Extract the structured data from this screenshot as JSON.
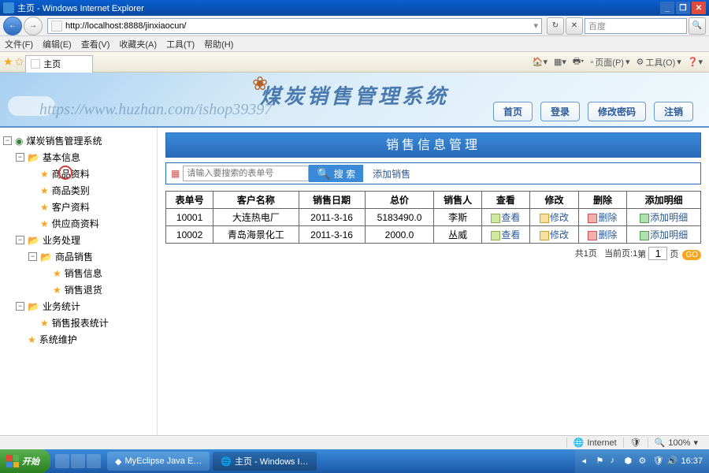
{
  "window": {
    "title": "主页 - Windows Internet Explorer",
    "url": "http://localhost:8888/jinxiaocun/",
    "search_engine_placeholder": "百度"
  },
  "menubar": [
    "文件(F)",
    "编辑(E)",
    "查看(V)",
    "收藏夹(A)",
    "工具(T)",
    "帮助(H)"
  ],
  "tab": {
    "title": "主页"
  },
  "ie_toolbar": {
    "page": "页面(P)",
    "tools": "工具(O)"
  },
  "banner": {
    "system_title": "煤炭销售管理系统",
    "watermark": "https://www.huzhan.com/ishop39397",
    "nav": {
      "home": "首页",
      "login": "登录",
      "chpwd": "修改密码",
      "logout": "注销"
    }
  },
  "tree": {
    "root": "煤炭销售管理系统",
    "basic": {
      "label": "基本信息",
      "items": [
        "商品资料",
        "商品类别",
        "客户资料",
        "供应商资料"
      ]
    },
    "biz": {
      "label": "业务处理",
      "sales": {
        "label": "商品销售",
        "items": [
          "销售信息",
          "销售退货"
        ]
      }
    },
    "stat": {
      "label": "业务统计",
      "items": [
        "销售报表统计"
      ]
    },
    "maint": "系统维护"
  },
  "page": {
    "title": "销售信息管理",
    "search_placeholder": "请输入要搜索的表单号",
    "search_btn": "搜 索",
    "add_link": "添加销售"
  },
  "table": {
    "headers": [
      "表单号",
      "客户名称",
      "销售日期",
      "总价",
      "销售人",
      "查看",
      "修改",
      "删除",
      "添加明细"
    ],
    "actions": {
      "view": "查看",
      "edit": "修改",
      "del": "删除",
      "add": "添加明细"
    },
    "rows": [
      {
        "id": "10001",
        "customer": "大连热电厂",
        "date": "2011-3-16",
        "total": "5183490.0",
        "seller": "李斯"
      },
      {
        "id": "10002",
        "customer": "青岛海景化工",
        "date": "2011-3-16",
        "total": "2000.0",
        "seller": "丛威"
      }
    ]
  },
  "pager": {
    "total_pages_label": "共1页",
    "current_label": "当前页:1",
    "di": "第",
    "ye": "页",
    "page_input": "1"
  },
  "statusbar": {
    "zone": "Internet",
    "zoom": "100%"
  },
  "taskbar": {
    "start": "开始",
    "items": [
      "MyEclipse Java E…",
      "主页 - Windows I…"
    ],
    "clock": "16:37"
  }
}
